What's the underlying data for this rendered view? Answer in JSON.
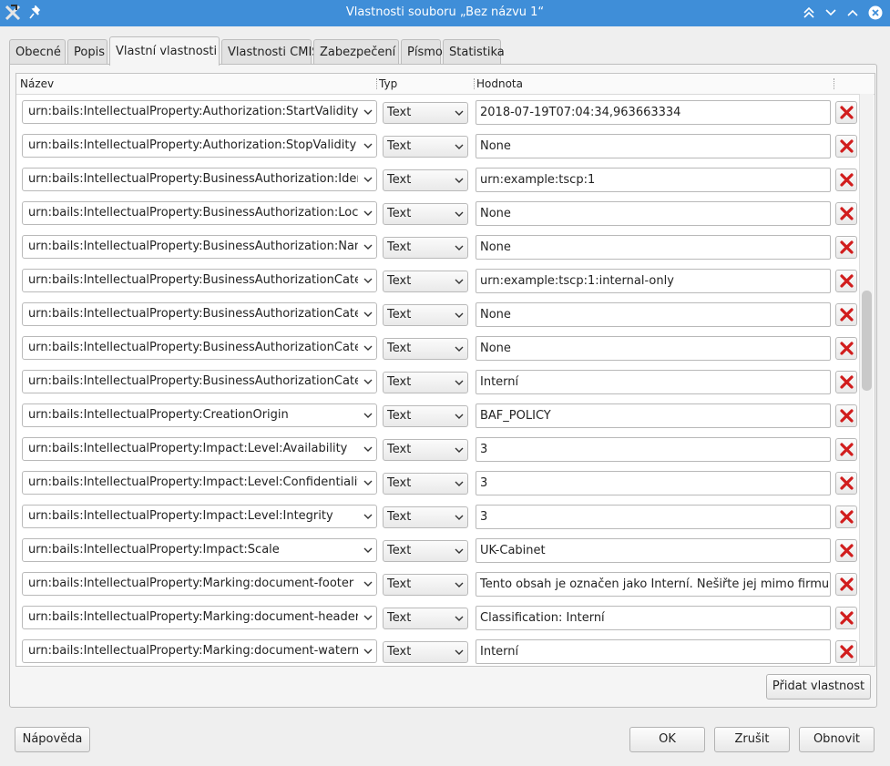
{
  "window": {
    "title": "Vlastnosti souboru „Bez názvu 1“"
  },
  "tabs": [
    {
      "label": "Obecné"
    },
    {
      "label": "Popis"
    },
    {
      "label": "Vlastní vlastnosti",
      "active": true
    },
    {
      "label": "Vlastnosti CMIS"
    },
    {
      "label": "Zabezpečení"
    },
    {
      "label": "Písmo"
    },
    {
      "label": "Statistika"
    }
  ],
  "table": {
    "headers": {
      "name": "Název",
      "type": "Typ",
      "value": "Hodnota"
    },
    "rows": [
      {
        "name": "urn:bails:IntellectualProperty:Authorization:StartValidity",
        "type": "Text",
        "value": "2018-07-19T07:04:34,963663334"
      },
      {
        "name": "urn:bails:IntellectualProperty:Authorization:StopValidity",
        "type": "Text",
        "value": "None"
      },
      {
        "name": "urn:bails:IntellectualProperty:BusinessAuthorization:Identifier",
        "type": "Text",
        "value": "urn:example:tscp:1"
      },
      {
        "name": "urn:bails:IntellectualProperty:BusinessAuthorization:Locator",
        "type": "Text",
        "value": "None"
      },
      {
        "name": "urn:bails:IntellectualProperty:BusinessAuthorization:Name",
        "type": "Text",
        "value": "None"
      },
      {
        "name": "urn:bails:IntellectualProperty:BusinessAuthorizationCategory",
        "type": "Text",
        "value": "urn:example:tscp:1:internal-only"
      },
      {
        "name": "urn:bails:IntellectualProperty:BusinessAuthorizationCategory",
        "type": "Text",
        "value": "None"
      },
      {
        "name": "urn:bails:IntellectualProperty:BusinessAuthorizationCategory",
        "type": "Text",
        "value": "None"
      },
      {
        "name": "urn:bails:IntellectualProperty:BusinessAuthorizationCategory",
        "type": "Text",
        "value": "Interní"
      },
      {
        "name": "urn:bails:IntellectualProperty:CreationOrigin",
        "type": "Text",
        "value": "BAF_POLICY"
      },
      {
        "name": "urn:bails:IntellectualProperty:Impact:Level:Availability",
        "type": "Text",
        "value": "3"
      },
      {
        "name": "urn:bails:IntellectualProperty:Impact:Level:Confidentiality",
        "type": "Text",
        "value": "3"
      },
      {
        "name": "urn:bails:IntellectualProperty:Impact:Level:Integrity",
        "type": "Text",
        "value": "3"
      },
      {
        "name": "urn:bails:IntellectualProperty:Impact:Scale",
        "type": "Text",
        "value": "UK-Cabinet"
      },
      {
        "name": "urn:bails:IntellectualProperty:Marking:document-footer",
        "type": "Text",
        "value": "Tento obsah je označen jako Interní. Nešiřte jej mimo firmu."
      },
      {
        "name": "urn:bails:IntellectualProperty:Marking:document-header",
        "type": "Text",
        "value": "Classification: Interní"
      },
      {
        "name": "urn:bails:IntellectualProperty:Marking:document-watermark",
        "type": "Text",
        "value": "Interní"
      }
    ]
  },
  "buttons": {
    "add_property": "Přidat vlastnost",
    "help": "Nápověda",
    "ok": "OK",
    "cancel": "Zrušit",
    "reset": "Obnovit"
  },
  "colors": {
    "titlebar": "#3f8ed8",
    "delete_icon": "#d11d1d"
  },
  "icons": {
    "app": "libreoffice-icon",
    "pin": "pin-icon",
    "window_controls": [
      "keep-above-icon",
      "minimize-icon",
      "maximize-icon",
      "close-icon"
    ],
    "row_delete": "delete-icon",
    "dropdown": "chevron-down-icon"
  }
}
